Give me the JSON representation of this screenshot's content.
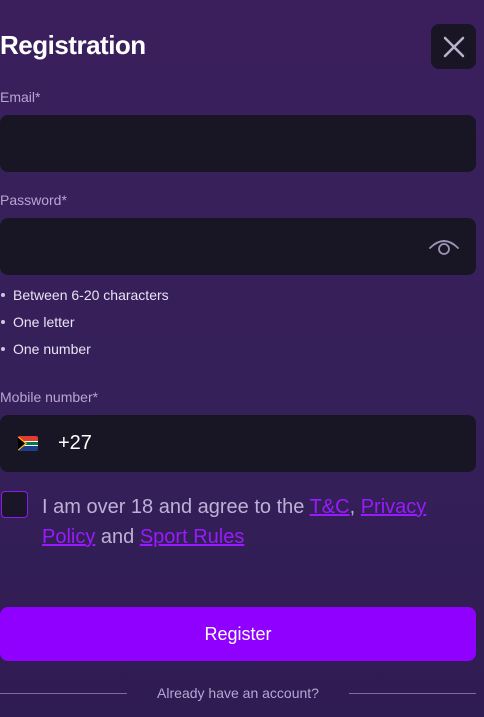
{
  "header": {
    "title": "Registration",
    "close_icon": "close-icon"
  },
  "form": {
    "email": {
      "label": "Email*",
      "value": "",
      "placeholder": ""
    },
    "password": {
      "label": "Password*",
      "value": "",
      "placeholder": "",
      "rules": [
        "Between 6-20 characters",
        "One letter",
        "One number"
      ],
      "toggle_icon": "eye-icon"
    },
    "mobile": {
      "label": "Mobile number*",
      "country_code": "+27",
      "flag_icon": "south-africa-flag-icon",
      "value": ""
    },
    "agreement": {
      "checked": false,
      "text_1": "I am over 18 and agree to the ",
      "link_1": "T&C",
      "sep_1": ", ",
      "link_2": "Privacy Policy",
      "sep_2": " and ",
      "link_3": "Sport Rules"
    },
    "register_label": "Register"
  },
  "footer": {
    "already_text": "Already have an account?"
  },
  "colors": {
    "accent": "#8f00ff",
    "link": "#9a1aff",
    "field_bg": "#181624",
    "page_bg": "#36205a"
  }
}
